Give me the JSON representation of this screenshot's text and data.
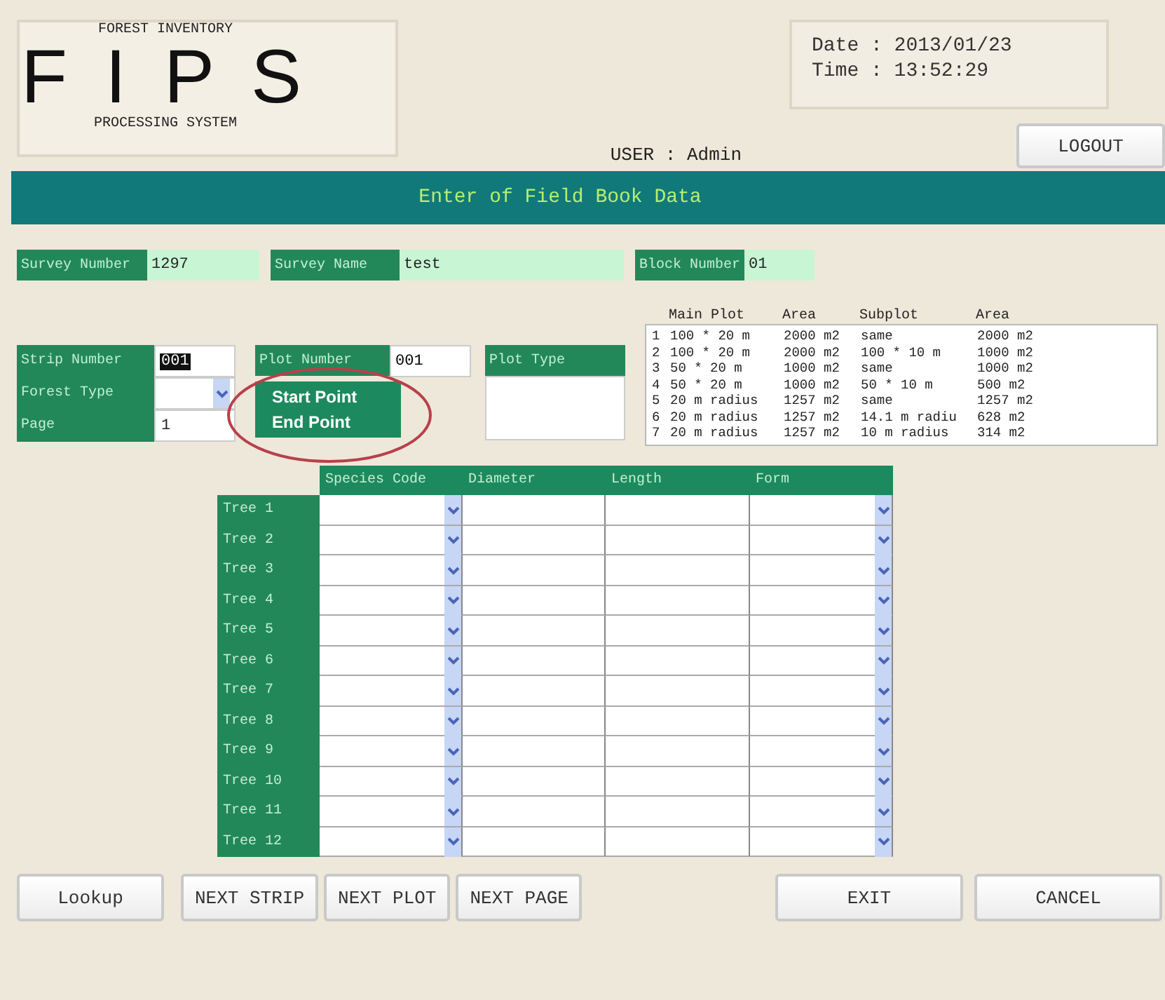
{
  "header": {
    "logo": {
      "top": "FOREST INVENTORY",
      "letters": "F I P S",
      "bottom": "PROCESSING SYSTEM"
    },
    "date": "Date : 2013/01/23",
    "time": "Time : 13:52:29",
    "user": "USER : Admin",
    "logout": "LOGOUT"
  },
  "title_bar": "Enter of Field Book Data",
  "survey_fields": [
    {
      "label": "Survey Number",
      "value": "1297"
    },
    {
      "label": "Survey Name",
      "value": "test"
    },
    {
      "label": "Block Number",
      "value": "01"
    }
  ],
  "strip_fields": [
    {
      "label": "Strip Number",
      "kind": "text",
      "value": "001",
      "value_selected": true
    },
    {
      "label": "Forest Type",
      "kind": "select"
    },
    {
      "label": "Page",
      "kind": "text",
      "value": "1",
      "value_selected": false
    }
  ],
  "plot_number": {
    "label": "Plot Number",
    "value": "001",
    "dropdown": {
      "expanded": true,
      "options": [
        "Start Point",
        "End Point"
      ]
    }
  },
  "plot_type": {
    "label": "Plot Type"
  },
  "plot_table": {
    "columns": [
      "Main Plot",
      "Area",
      "Subplot",
      "Area"
    ],
    "rows": [
      {
        "number": "1",
        "cells": [
          "100 * 20 m",
          "2000 m2",
          "same",
          "2000 m2"
        ]
      },
      {
        "number": "2",
        "cells": [
          "100 * 20 m",
          "2000 m2",
          "100 * 10 m",
          "1000 m2"
        ]
      },
      {
        "number": "3",
        "cells": [
          "50 * 20 m",
          "1000 m2",
          "same",
          "1000 m2"
        ]
      },
      {
        "number": "4",
        "cells": [
          "50 * 20 m",
          "1000 m2",
          "50 * 10 m",
          "500 m2"
        ]
      },
      {
        "number": "5",
        "cells": [
          "20 m radius",
          "1257 m2",
          "same",
          "1257 m2"
        ]
      },
      {
        "number": "6",
        "cells": [
          "20 m radius",
          "1257 m2",
          "14.1 m radiu",
          "628 m2"
        ]
      },
      {
        "number": "7",
        "cells": [
          "20 m radius",
          "1257 m2",
          "10 m radius",
          "314 m2"
        ]
      }
    ]
  },
  "tree_grid": {
    "columns": [
      {
        "label": "Species Code",
        "kind": "select"
      },
      {
        "label": "Diameter",
        "kind": "text"
      },
      {
        "label": "Length",
        "kind": "text"
      },
      {
        "label": "Form",
        "kind": "select"
      }
    ],
    "rows": [
      "Tree 1",
      "Tree 2",
      "Tree 3",
      "Tree 4",
      "Tree 5",
      "Tree 6",
      "Tree 7",
      "Tree 8",
      "Tree 9",
      "Tree 10",
      "Tree 11",
      "Tree 12"
    ]
  },
  "nav_buttons": [
    "Lookup",
    "NEXT STRIP",
    "NEXT PLOT",
    "NEXT PAGE"
  ],
  "action_buttons": [
    "EXIT",
    "CANCEL"
  ]
}
